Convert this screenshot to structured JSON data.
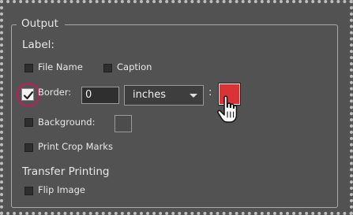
{
  "output": {
    "title": "Output",
    "label_heading": "Label:",
    "file_name": "File Name",
    "caption": "Caption",
    "border": "Border:",
    "border_width": "0",
    "border_unit": "inches",
    "colon": ":",
    "border_color": "#d93337",
    "background": "Background:",
    "print_crop_marks": "Print Crop Marks"
  },
  "transfer": {
    "heading": "Transfer Printing",
    "flip_image": "Flip Image"
  },
  "states": {
    "file_name_checked": false,
    "caption_checked": false,
    "border_checked": true,
    "background_checked": false,
    "print_crop_marks_checked": false,
    "flip_image_checked": false
  },
  "icons": [
    "checkmark-icon",
    "chevron-down-icon",
    "hand-pointer-icon"
  ]
}
